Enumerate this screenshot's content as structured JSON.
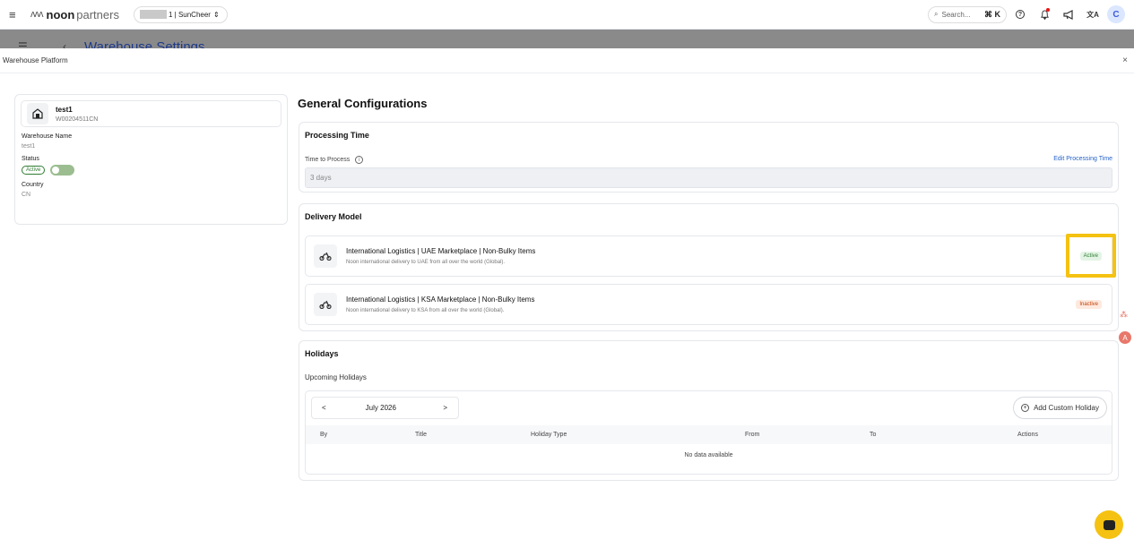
{
  "topbar": {
    "menu_icon": "≡",
    "brand_waves": "ʌʌʌ",
    "brand_noon": "noon",
    "brand_partners": "partners",
    "store_label": "1 | SunCheer",
    "store_chevron": "⇕",
    "search_placeholder": "Search...",
    "search_shortcut": "⌘ K",
    "help_icon": "?",
    "bell_icon": "🔔",
    "megaphone_icon": "📢",
    "translate_icon": "文A",
    "avatar_initial": "C"
  },
  "underlay": {
    "title": "Warehouse Settings"
  },
  "modal": {
    "title": "Warehouse Platform",
    "close": "×"
  },
  "warehouse": {
    "name": "test1",
    "code": "W00204511CN",
    "name_label": "Warehouse Name",
    "name_value": "test1",
    "status_label": "Status",
    "status_value": "Active",
    "status_enabled": true,
    "country_label": "Country",
    "country_value": "CN"
  },
  "general": {
    "title": "General Configurations"
  },
  "processing": {
    "title": "Processing Time",
    "field_label": "Time to Process",
    "edit_link": "Edit Processing Time",
    "value": "3 days"
  },
  "delivery": {
    "title": "Delivery Model",
    "items": [
      {
        "title": "International Logistics | UAE Marketplace | Non-Bulky Items",
        "description": "Noon international delivery to UAE from all over the world (Global).",
        "status": "Active"
      },
      {
        "title": "International Logistics | KSA Marketplace | Non-Bulky Items",
        "description": "Noon international delivery to KSA from all over the world (Global).",
        "status": "Inactive"
      }
    ]
  },
  "holidays": {
    "title": "Holidays",
    "subtitle": "Upcoming Holidays",
    "prev": "<",
    "month": "July 2026",
    "next": ">",
    "add_button": "Add Custom Holiday",
    "columns": [
      "By",
      "Title",
      "Holiday Type",
      "From",
      "To",
      "Actions"
    ],
    "empty_text": "No data available"
  },
  "colors": {
    "accent_link": "#2563c9",
    "highlight": "#f5c211",
    "active_green": "#2e7d32",
    "inactive_orange": "#c2410c"
  }
}
